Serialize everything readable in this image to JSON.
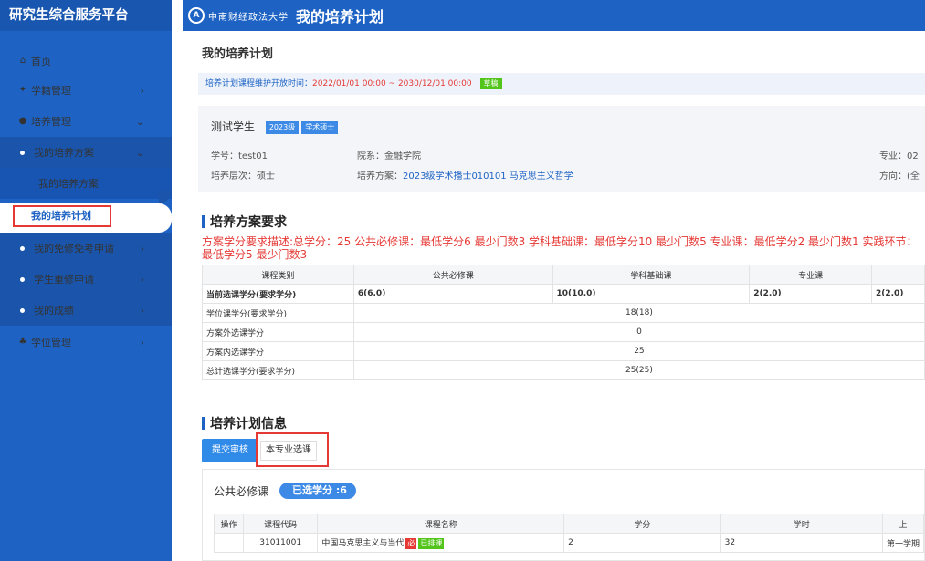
{
  "sidebar": {
    "brand": "研究生综合服务平台",
    "items": [
      {
        "label": "首页",
        "icon": "home-icon"
      },
      {
        "label": "学籍管理",
        "icon": "student-status-icon"
      },
      {
        "label": "培养管理",
        "icon": "person-icon"
      },
      {
        "label": "我的培养方案"
      },
      {
        "label": "我的培养方案"
      },
      {
        "label": "我的培养计划"
      },
      {
        "label": "我的免修免考申请"
      },
      {
        "label": "学生重修申请"
      },
      {
        "label": "我的成绩"
      },
      {
        "label": "学位管理",
        "icon": "degree-icon"
      }
    ]
  },
  "header": {
    "logo_text": "中南财经政法大学",
    "title": "我的培养计划"
  },
  "main": {
    "page_title": "我的培养计划",
    "notice": {
      "label": "培养计划课程维护开放时间：",
      "time": "2022/01/01 00:00 ~ 2030/12/01 00:00",
      "status": "草稿"
    },
    "student": {
      "name": "测试学生",
      "grade_tag": "2023级",
      "type_tag": "学术硕士",
      "student_id_label": "学号：",
      "student_id": "test01",
      "dept_label": "院系：",
      "dept": "金融学院",
      "major_label": "专业：",
      "major": "02",
      "level_label": "培养层次：",
      "level": "硕士",
      "plan_label": "培养方案：",
      "plan": "2023级学术播士010101 马克思主义哲学",
      "direction_label": "方向：",
      "direction": "(全"
    },
    "requirements": {
      "title": "培养方案要求",
      "desc": "方案学分要求描述:总学分：25    公共必修课：最低学分6 最少门数3    学科基础课：最低学分10 最少门数5    专业课：最低学分2 最少门数1    实践环节：最低学分5 最少门数3",
      "headers": [
        "课程类别",
        "公共必修课",
        "学科基础课",
        "专业课",
        ""
      ],
      "rows": [
        {
          "label": "当前选课学分(要求学分)",
          "c1": "6(6.0)",
          "c2": "10(10.0)",
          "c3": "2(2.0)",
          "c4": "2(2.0)"
        },
        {
          "label": "学位课学分(要求学分)",
          "merged": "18(18)"
        },
        {
          "label": "方案外选课学分",
          "merged": "0"
        },
        {
          "label": "方案内选课学分",
          "merged": "25"
        },
        {
          "label": "总计选课学分(要求学分)",
          "merged": "25(25)"
        }
      ]
    },
    "plan_info": {
      "title": "培养计划信息",
      "submit_button": "提交审核",
      "major_course_button": "本专业选课"
    },
    "course_section": {
      "title": "公共必修课",
      "credits_pill": "已选学分 :6",
      "headers": [
        "操作",
        "课程代码",
        "课程名称",
        "学分",
        "学时",
        "上"
      ],
      "rows": [
        {
          "op": "",
          "code": "31011001",
          "name": "中国马克思主义与当代",
          "tag1": "必",
          "tag2": "已排课",
          "credit": "2",
          "hours": "32",
          "term": "第一学期"
        }
      ]
    }
  }
}
